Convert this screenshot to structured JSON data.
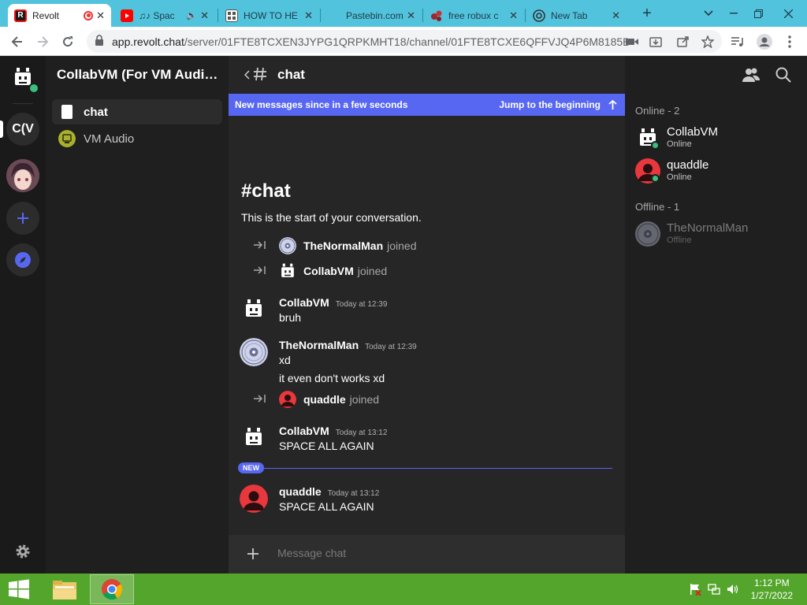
{
  "browser": {
    "tabs": [
      {
        "title": "Revolt",
        "favicon": "revolt-logo",
        "active": true,
        "recording": true
      },
      {
        "title": "♫♪ Spac",
        "favicon": "youtube-logo",
        "audio": true
      },
      {
        "title": "HOW TO HE",
        "favicon": "page-grid-icon"
      },
      {
        "title": "Pastebin.com",
        "favicon": "pastebin-logo"
      },
      {
        "title": "free robux c",
        "favicon": "red-dots-icon"
      },
      {
        "title": "New Tab",
        "favicon": "chrome-logo"
      }
    ],
    "url_host": "app.revolt.chat",
    "url_path": "/server/01FTE8TCXEN3JYPG1QRPKMHT18/channel/01FTE8TCXE6QFFVJQ4P6M8185B"
  },
  "server": {
    "name": "CollabVM (For VM Audio ...",
    "rail_initials": "C(V"
  },
  "channels": [
    {
      "name": "chat",
      "active": true,
      "icon": "text-channel-icon"
    },
    {
      "name": "VM Audio",
      "active": false,
      "icon": "voice-channel-icon"
    }
  ],
  "channel_header": {
    "name": "chat"
  },
  "banner": {
    "text": "New messages since in a few seconds",
    "jump": "Jump to the beginning"
  },
  "intro": {
    "title": "#chat",
    "subtitle": "This is the start of your conversation."
  },
  "system": [
    {
      "user": "TheNormalMan",
      "verb": "joined",
      "avatar": "disc-avatar"
    },
    {
      "user": "CollabVM",
      "verb": "joined",
      "avatar": "bot-avatar"
    },
    {
      "user": "quaddle",
      "verb": "joined",
      "avatar": "red-user-avatar"
    }
  ],
  "messages": [
    {
      "user": "CollabVM",
      "time": "Today at 12:39",
      "lines": [
        "bruh"
      ],
      "avatar": "bot-avatar"
    },
    {
      "user": "TheNormalMan",
      "time": "Today at 12:39",
      "lines": [
        "xd",
        "it even don't works xd"
      ],
      "avatar": "disc-avatar"
    },
    {
      "user": "CollabVM",
      "time": "Today at 13:12",
      "lines": [
        "SPACE ALL AGAIN"
      ],
      "avatar": "bot-avatar"
    },
    {
      "user": "quaddle",
      "time": "Today at 13:12",
      "lines": [
        "SPACE ALL AGAIN"
      ],
      "avatar": "red-user-avatar"
    }
  ],
  "new_divider": "NEW",
  "composer": {
    "placeholder": "Message chat"
  },
  "members": {
    "online_header": "Online - 2",
    "offline_header": "Offline - 1",
    "online": [
      {
        "name": "CollabVM",
        "status": "Online",
        "avatar": "bot-avatar"
      },
      {
        "name": "quaddle",
        "status": "Online",
        "avatar": "red-user-avatar"
      }
    ],
    "offline": [
      {
        "name": "TheNormalMan",
        "status": "Offline",
        "avatar": "disc-avatar"
      }
    ]
  },
  "taskbar": {
    "time": "1:12 PM",
    "date": "1/27/2022"
  },
  "colors": {
    "accent": "#5867f2",
    "online": "#3abf7e",
    "quaddle": "#e8373d",
    "taskbar": "#54a52b",
    "tabstrip": "#52c3dd"
  }
}
